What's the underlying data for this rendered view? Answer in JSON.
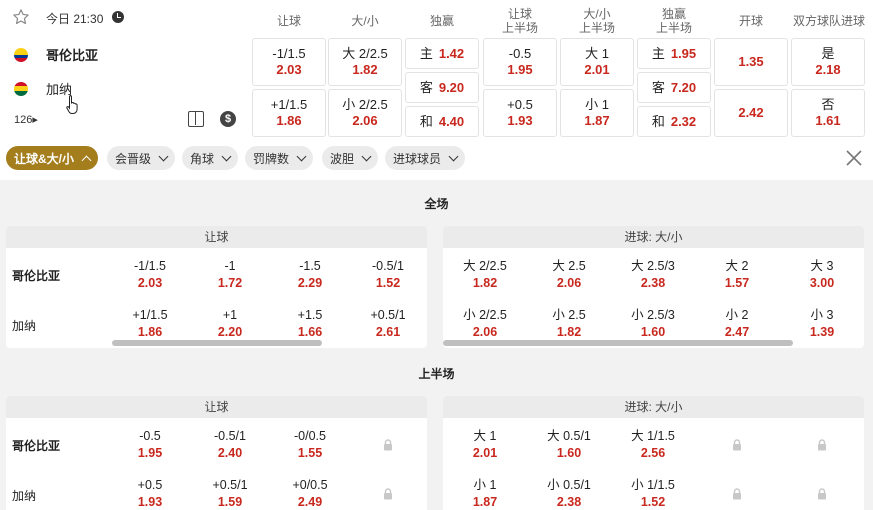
{
  "match": {
    "date_time": "今日 21:30",
    "home": "哥伦比亚",
    "away": "加纳",
    "more_count": "126",
    "more_arrow": "▸",
    "dollar": "$"
  },
  "columns": [
    "让球",
    "大/小",
    "独赢",
    "让球\n上半场",
    "大/小\n上半场",
    "独赢\n上半场",
    "开球",
    "双方球队进球"
  ],
  "top_odds": {
    "hdp": [
      {
        "line": "-1/1.5",
        "odd": "2.03"
      },
      {
        "line": "+1/1.5",
        "odd": "1.86"
      }
    ],
    "ou": [
      {
        "line": "大 2/2.5",
        "odd": "1.82"
      },
      {
        "line": "小 2/2.5",
        "odd": "2.06"
      }
    ],
    "win": [
      {
        "label": "主",
        "odd": "1.42"
      },
      {
        "label": "客",
        "odd": "9.20"
      },
      {
        "label": "和",
        "odd": "4.40"
      }
    ],
    "hdp_h1": [
      {
        "line": "-0.5",
        "odd": "1.95"
      },
      {
        "line": "+0.5",
        "odd": "1.93"
      }
    ],
    "ou_h1": [
      {
        "line": "大 1",
        "odd": "2.01"
      },
      {
        "line": "小 1",
        "odd": "1.87"
      }
    ],
    "win_h1": [
      {
        "label": "主",
        "odd": "1.95"
      },
      {
        "label": "客",
        "odd": "7.20"
      },
      {
        "label": "和",
        "odd": "2.32"
      }
    ],
    "kickoff": [
      "1.35",
      "2.42"
    ],
    "btts": [
      {
        "line": "是",
        "odd": "2.18"
      },
      {
        "line": "否",
        "odd": "1.61"
      }
    ]
  },
  "filters": [
    "让球&大/小",
    "会晋级",
    "角球",
    "罚牌数",
    "波胆",
    "进球球员"
  ],
  "sections": [
    {
      "title": "全场",
      "left": {
        "head": "让球",
        "teams": [
          "哥伦比亚",
          "加纳"
        ],
        "rows": [
          [
            {
              "line": "-1/1.5",
              "odd": "2.03"
            },
            {
              "line": "-1",
              "odd": "1.72"
            },
            {
              "line": "-1.5",
              "odd": "2.29"
            },
            {
              "line": "-0.5/1",
              "odd": "1.52"
            }
          ],
          [
            {
              "line": "+1/1.5",
              "odd": "1.86"
            },
            {
              "line": "+1",
              "odd": "2.20"
            },
            {
              "line": "+1.5",
              "odd": "1.66"
            },
            {
              "line": "+0.5/1",
              "odd": "2.61"
            }
          ]
        ]
      },
      "right": {
        "head": "进球: 大/小",
        "rows": [
          [
            {
              "line": "大 2/2.5",
              "odd": "1.82"
            },
            {
              "line": "大 2.5",
              "odd": "2.06"
            },
            {
              "line": "大 2.5/3",
              "odd": "2.38"
            },
            {
              "line": "大 2",
              "odd": "1.57"
            },
            {
              "line": "大 3",
              "odd": "3.00"
            }
          ],
          [
            {
              "line": "小 2/2.5",
              "odd": "2.06"
            },
            {
              "line": "小 2.5",
              "odd": "1.82"
            },
            {
              "line": "小 2.5/3",
              "odd": "1.60"
            },
            {
              "line": "小 2",
              "odd": "2.47"
            },
            {
              "line": "小 3",
              "odd": "1.39"
            }
          ]
        ]
      }
    },
    {
      "title": "上半场",
      "left": {
        "head": "让球",
        "teams": [
          "哥伦比亚",
          "加纳"
        ],
        "rows": [
          [
            {
              "line": "-0.5",
              "odd": "1.95"
            },
            {
              "line": "-0.5/1",
              "odd": "2.40"
            },
            {
              "line": "-0/0.5",
              "odd": "1.55"
            },
            {
              "locked": true
            }
          ],
          [
            {
              "line": "+0.5",
              "odd": "1.93"
            },
            {
              "line": "+0.5/1",
              "odd": "1.59"
            },
            {
              "line": "+0/0.5",
              "odd": "2.49"
            },
            {
              "locked": true
            }
          ]
        ]
      },
      "right": {
        "head": "进球: 大/小",
        "rows": [
          [
            {
              "line": "大 1",
              "odd": "2.01"
            },
            {
              "line": "大 0.5/1",
              "odd": "1.60"
            },
            {
              "line": "大 1/1.5",
              "odd": "2.56"
            },
            {
              "locked": true
            },
            {
              "locked": true
            }
          ],
          [
            {
              "line": "小 1",
              "odd": "1.87"
            },
            {
              "line": "小 0.5/1",
              "odd": "2.38"
            },
            {
              "line": "小 1/1.5",
              "odd": "1.52"
            },
            {
              "locked": true
            },
            {
              "locked": true
            }
          ]
        ]
      }
    }
  ],
  "colors": {
    "accent": "#a47d1c",
    "odd_red": "#c8281e"
  }
}
